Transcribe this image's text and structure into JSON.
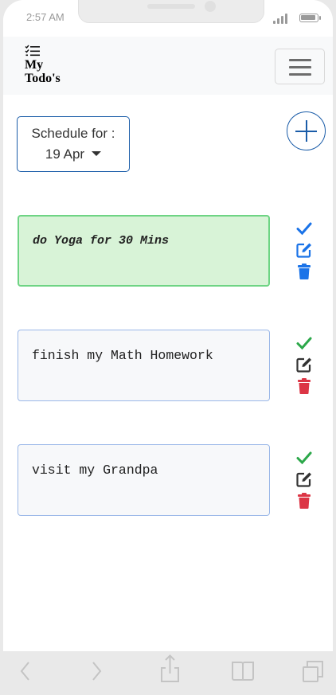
{
  "status_bar": {
    "time": "2:57 AM"
  },
  "navbar": {
    "brand_icon": "checklist-icon",
    "brand_line1": "My",
    "brand_line2": "Todo's",
    "menu_icon": "hamburger-menu-icon"
  },
  "schedule": {
    "label": "Schedule for :",
    "date": "19 Apr",
    "add_icon": "plus-icon"
  },
  "todos": [
    {
      "text": "do Yoga for 30 Mins",
      "completed": true
    },
    {
      "text": "finish my Math Homework",
      "completed": false
    },
    {
      "text": "visit my Grandpa",
      "completed": false
    }
  ],
  "colors": {
    "accent": "#1a5ca8",
    "check_done": "#1a73e8",
    "check_pending": "#2ca84a",
    "delete_done": "#1a73e8",
    "delete_pending": "#dc3545",
    "done_bg": "#d8f3d7",
    "done_border": "#6ed484"
  },
  "browser_bar": {
    "icons": [
      "back-icon",
      "forward-icon",
      "share-icon",
      "bookmarks-icon",
      "tabs-icon"
    ]
  }
}
